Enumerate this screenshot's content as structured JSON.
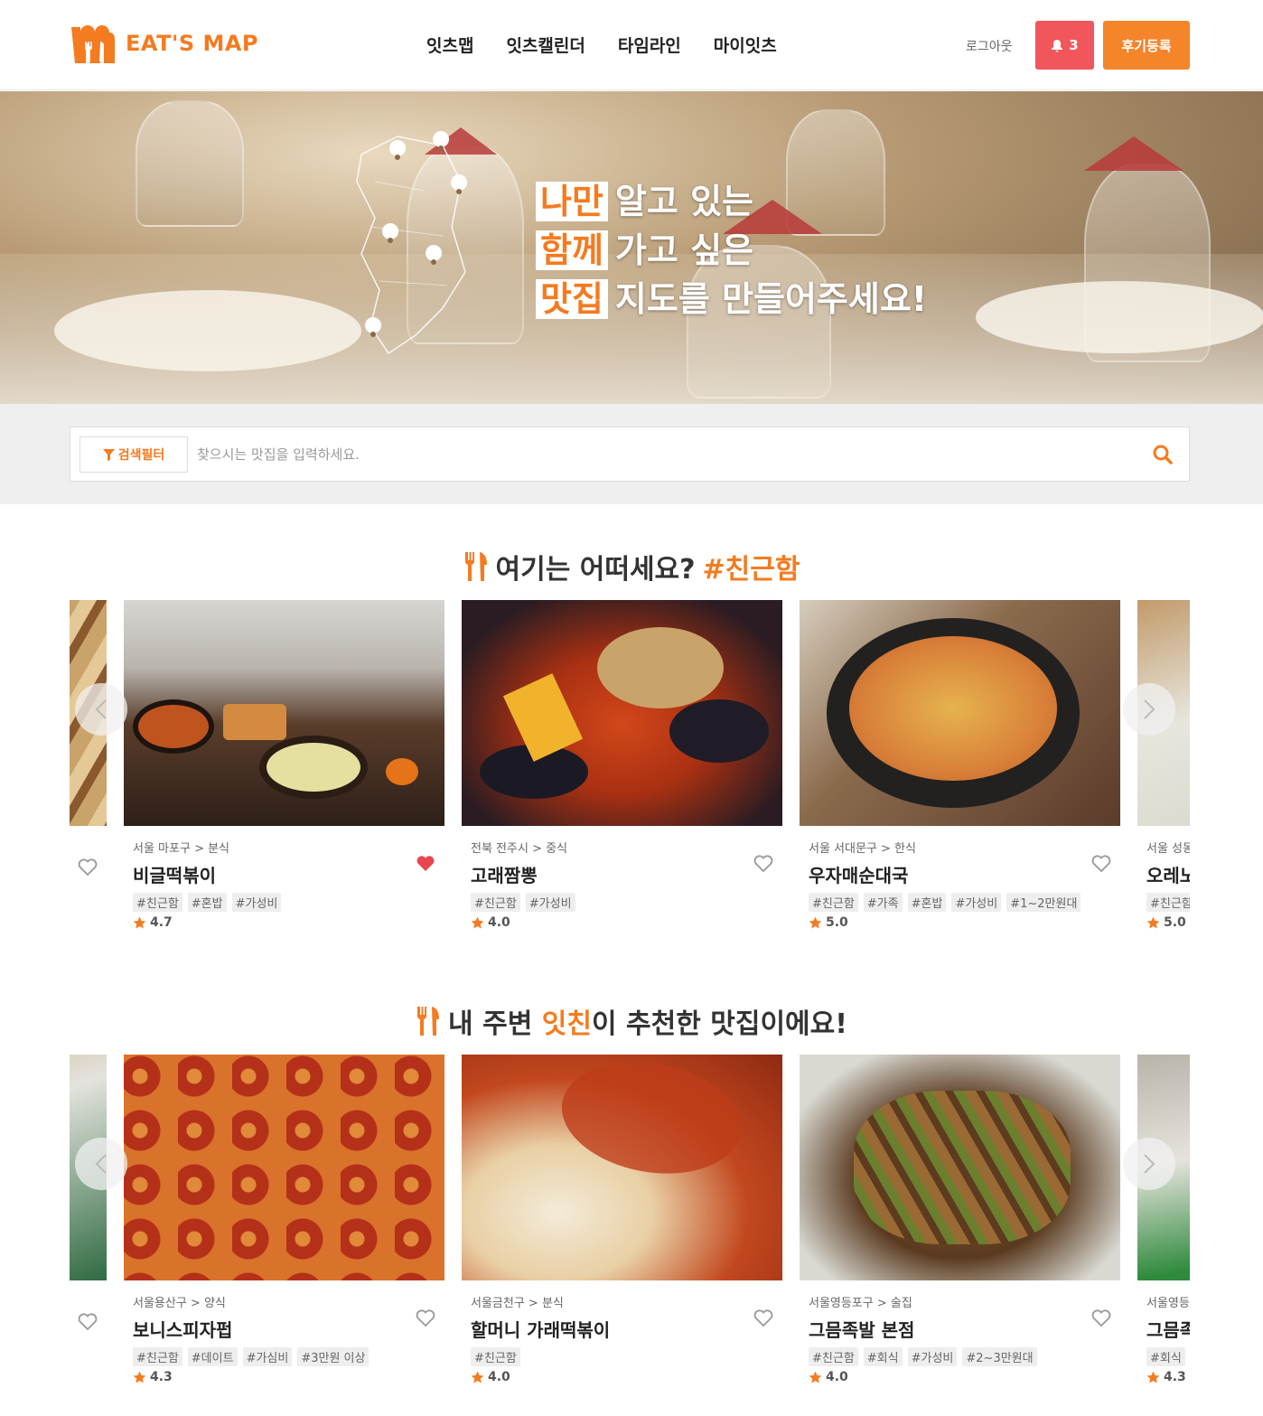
{
  "header": {
    "logo_text": "EAT'S MAP",
    "nav": [
      "잇츠맵",
      "잇츠캘린더",
      "타임라인",
      "마이잇츠"
    ],
    "logout": "로그아웃",
    "notification_count": "3",
    "review_button": "후기등록"
  },
  "hero": {
    "lines": [
      {
        "highlight": "나만",
        "text": "알고 있는"
      },
      {
        "highlight": "함께",
        "text": "가고 싶은"
      },
      {
        "highlight": "맛집",
        "text": "지도를 만들어주세요!"
      }
    ]
  },
  "search": {
    "filter_label": "검색필터",
    "placeholder": "찾으시는 맛집을 입력하세요."
  },
  "section1": {
    "title_main": "여기는 어떠세요?",
    "title_accent": "#친근함",
    "cards": [
      {
        "location": "서울 마포구 > 분식",
        "name": "비글떡볶이",
        "tags": [
          "#친근함",
          "#혼밥",
          "#가성비"
        ],
        "rating": "4.7",
        "liked": true
      },
      {
        "location": "전북 전주시 > 중식",
        "name": "고래짬뽕",
        "tags": [
          "#친근함",
          "#가성비"
        ],
        "rating": "4.0",
        "liked": false
      },
      {
        "location": "서울 서대문구 > 한식",
        "name": "우자매순대국",
        "tags": [
          "#친근함",
          "#가족",
          "#혼밥",
          "#가성비",
          "#1~2만원대"
        ],
        "rating": "5.0",
        "liked": false
      },
      {
        "location": "서울 성동",
        "name": "오레노",
        "tags": [
          "#친근함"
        ],
        "rating": "5.0",
        "liked": false
      }
    ]
  },
  "section2": {
    "title_prefix": "내 주변",
    "title_accent": "잇친",
    "title_suffix": "이 추천한 맛집이에요!",
    "cards": [
      {
        "location": "서울용산구 > 양식",
        "name": "보니스피자펍",
        "tags": [
          "#친근함",
          "#데이트",
          "#가심비",
          "#3만원 이상"
        ],
        "rating": "4.3",
        "liked": false
      },
      {
        "location": "서울금천구 > 분식",
        "name": "할머니 가래떡볶이",
        "tags": [
          "#친근함"
        ],
        "rating": "4.0",
        "liked": false
      },
      {
        "location": "서울영등포구 > 술집",
        "name": "그믐족발 본점",
        "tags": [
          "#친근함",
          "#회식",
          "#가성비",
          "#2~3만원대"
        ],
        "rating": "4.0",
        "liked": false
      },
      {
        "location": "서울영등",
        "name": "그믐족",
        "tags": [
          "#회식"
        ],
        "rating": "4.3",
        "liked": false
      }
    ]
  },
  "colors": {
    "accent": "#f47b20",
    "alert": "#f0565b",
    "heart_active": "#e8464f"
  }
}
